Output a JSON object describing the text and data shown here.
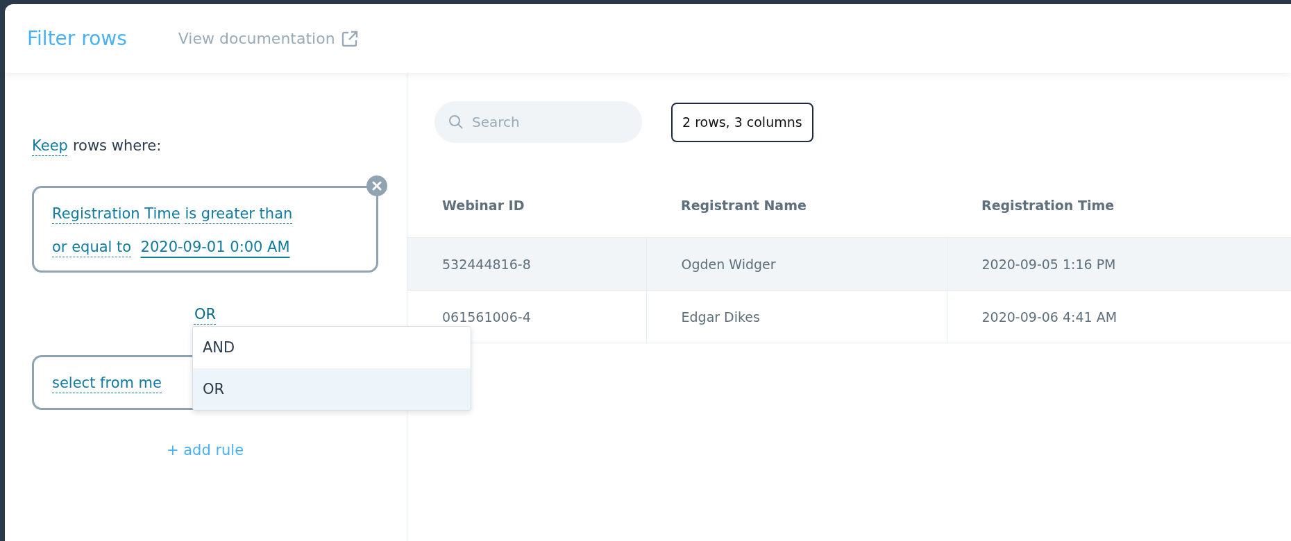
{
  "header": {
    "title": "Filter rows",
    "doc_link": "View documentation"
  },
  "filter": {
    "keep_word": "Keep",
    "keep_rest": "rows where:",
    "rules": [
      {
        "kind": "complete",
        "column": "Registration Time",
        "operator_lines": [
          "is greater than",
          "or equal to"
        ],
        "value": "2020-09-01 0:00 AM"
      },
      {
        "kind": "empty",
        "column": "select from me"
      }
    ],
    "connector": {
      "label": "OR",
      "expanded": true,
      "options": [
        {
          "label": "AND",
          "selected": false
        },
        {
          "label": "OR",
          "selected": true
        }
      ]
    },
    "add_rule": "+ add rule"
  },
  "toolbar": {
    "search": {
      "placeholder": "Search"
    },
    "summary": "2 rows, 3 columns"
  },
  "table": {
    "columns": [
      "Webinar ID",
      "Registrant Name",
      "Registration Time"
    ],
    "rows": [
      {
        "selected": true,
        "cells": [
          "532444816-8",
          "Ogden Widger",
          "2020-09-05 1:16 PM"
        ]
      },
      {
        "selected": false,
        "cells": [
          "061561006-4",
          "Edgar Dikes",
          "2020-09-06 4:41 AM"
        ]
      }
    ]
  }
}
